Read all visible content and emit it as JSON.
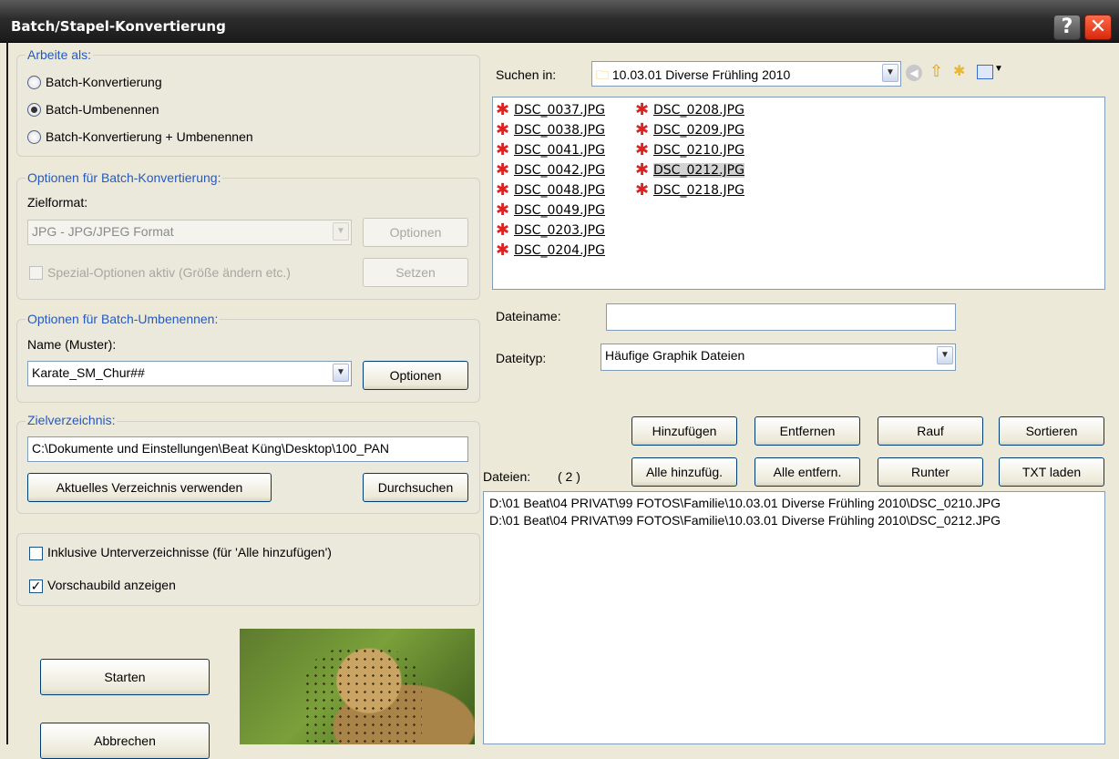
{
  "window": {
    "title": "Batch/Stapel-Konvertierung",
    "help": "?",
    "close": "✕"
  },
  "mode": {
    "group_label": "Arbeite als:",
    "options": [
      "Batch-Konvertierung",
      "Batch-Umbenennen",
      "Batch-Konvertierung + Umbenennen"
    ],
    "selected": "Batch-Umbenennen"
  },
  "convert": {
    "group_label": "Optionen für Batch-Konvertierung:",
    "format_label": "Zielformat:",
    "format_value": "JPG - JPG/JPEG Format",
    "options_button": "Optionen",
    "special_label": "Spezial-Optionen aktiv (Größe ändern etc.)",
    "set_button": "Setzen"
  },
  "rename": {
    "group_label": "Optionen für Batch-Umbenennen:",
    "pattern_label": "Name (Muster):",
    "pattern_value": "Karate_SM_Chur##",
    "options_button": "Optionen"
  },
  "target": {
    "group_label": "Zielverzeichnis:",
    "path": "C:\\Dokumente und Einstellungen\\Beat Küng\\Desktop\\100_PAN",
    "use_current_button": "Aktuelles Verzeichnis verwenden",
    "browse_button": "Durchsuchen"
  },
  "flags": {
    "include_sub": "Inklusive Unterverzeichnisse (für 'Alle hinzufügen')",
    "show_preview": "Vorschaubild anzeigen"
  },
  "actions": {
    "start": "Starten",
    "cancel": "Abbrechen"
  },
  "browser": {
    "look_in_label": "Suchen in:",
    "folder": "10.03.01 Diverse Frühling 2010",
    "files_col1": [
      "DSC_0037.JPG",
      "DSC_0038.JPG",
      "DSC_0041.JPG",
      "DSC_0042.JPG",
      "DSC_0048.JPG",
      "DSC_0049.JPG",
      "DSC_0203.JPG",
      "DSC_0204.JPG"
    ],
    "files_col2": [
      "DSC_0208.JPG",
      "DSC_0209.JPG",
      "DSC_0210.JPG",
      "DSC_0212.JPG",
      "DSC_0218.JPG"
    ],
    "selected_file": "DSC_0212.JPG",
    "filename_label": "Dateiname:",
    "filename_value": "",
    "filetype_label": "Dateityp:",
    "filetype_value": "Häufige Graphik Dateien"
  },
  "list_buttons": {
    "add": "Hinzufügen",
    "remove": "Entfernen",
    "up": "Rauf",
    "sort": "Sortieren",
    "add_all": "Alle hinzufüg.",
    "remove_all": "Alle entfern.",
    "down": "Runter",
    "load_txt": "TXT laden"
  },
  "file_list": {
    "label": "Dateien:",
    "count": "( 2 )",
    "items": [
      "D:\\01 Beat\\04 PRIVAT\\99 FOTOS\\Familie\\10.03.01 Diverse Frühling 2010\\DSC_0210.JPG",
      "D:\\01 Beat\\04 PRIVAT\\99 FOTOS\\Familie\\10.03.01 Diverse Frühling 2010\\DSC_0212.JPG"
    ]
  }
}
